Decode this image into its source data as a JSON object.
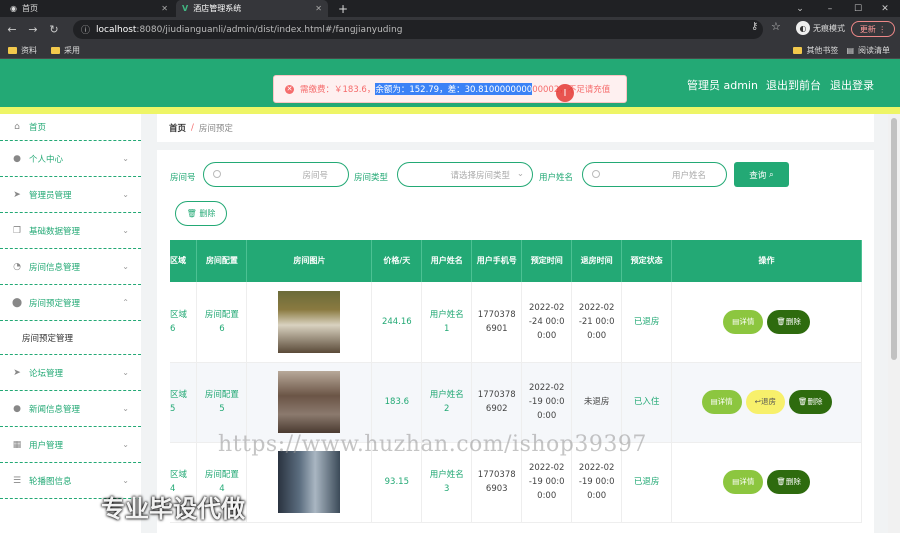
{
  "browser": {
    "tabs": [
      {
        "title": "首页"
      },
      {
        "title": "酒店管理系统"
      }
    ],
    "url_host": "localhost",
    "url_rest": ":8080/jiudianguanli/admin/dist/index.html#/fangjianyuding",
    "incognito_label": "无痕模式",
    "update_label": "更新",
    "bookmarks": [
      "资料",
      "采用"
    ],
    "bookmarks_right": [
      "其他书签",
      "阅读清单"
    ]
  },
  "header": {
    "admin_label": "管理员 admin",
    "front_label": "退出到前台",
    "logout_label": "退出登录",
    "accent": "#23a975"
  },
  "toast": {
    "prefix": "需缴费：￥183.6，",
    "selected": "余额为：152.79，差：30.8100000000",
    "suffix": "00002，不足请充值"
  },
  "sidebar": {
    "items": [
      {
        "label": "首页",
        "icon": "home-icon"
      },
      {
        "label": "个人中心",
        "icon": "user-icon"
      },
      {
        "label": "管理员管理",
        "icon": "send-icon"
      },
      {
        "label": "基础数据管理",
        "icon": "copy-icon"
      },
      {
        "label": "房间信息管理",
        "icon": "gauge-icon"
      },
      {
        "label": "房间预定管理",
        "icon": "pin-icon"
      },
      {
        "label": "论坛管理",
        "icon": "send-icon"
      },
      {
        "label": "新闻信息管理",
        "icon": "user-icon"
      },
      {
        "label": "用户管理",
        "icon": "chart-icon"
      },
      {
        "label": "轮播图信息",
        "icon": "sliders-icon"
      }
    ],
    "subitem": "房间预定管理"
  },
  "breadcrumb": {
    "home": "首页",
    "sep": "/",
    "current": "房间预定"
  },
  "search": {
    "room_no_label": "房间号",
    "room_no_placeholder": "房间号",
    "room_type_label": "房间类型",
    "room_type_placeholder": "请选择房间类型",
    "user_name_label": "用户姓名",
    "user_name_placeholder": "用户姓名",
    "query_label": "查询",
    "delete_label": "删除"
  },
  "table": {
    "headers": [
      "区域",
      "房间配置",
      "房间图片",
      "价格/天",
      "用户姓名",
      "用户手机号",
      "预定时间",
      "退房时间",
      "预定状态",
      "操作"
    ],
    "rows": [
      {
        "area": "区域\n6",
        "config": "房间配置\n6",
        "price": "244.16",
        "user": "用户姓名\n1",
        "phone": "1770378\n6901",
        "book": "2022-02\n-24 00:0\n0:00",
        "checkout": "2022-02\n-21 00:0\n0:00",
        "status": "已退房",
        "actions": [
          "详情",
          "删除"
        ]
      },
      {
        "area": "区域\n5",
        "config": "房间配置\n5",
        "price": "183.6",
        "user": "用户姓名\n2",
        "phone": "1770378\n6902",
        "book": "2022-02\n-19 00:0\n0:00",
        "checkout": "未退房",
        "status": "已入住",
        "actions": [
          "详情",
          "退房",
          "删除"
        ]
      },
      {
        "area": "区域\n4",
        "config": "房间配置\n4",
        "price": "93.15",
        "user": "用户姓名\n3",
        "phone": "1770378\n6903",
        "book": "2022-02\n-19 00:0\n0:00",
        "checkout": "2022-02\n-19 00:0\n0:00",
        "status": "已退房",
        "actions": [
          "详情",
          "删除"
        ]
      }
    ]
  },
  "watermark": {
    "url": "https://www.huzhan.com/ishop39397",
    "slogan": "专业毕设代做"
  }
}
